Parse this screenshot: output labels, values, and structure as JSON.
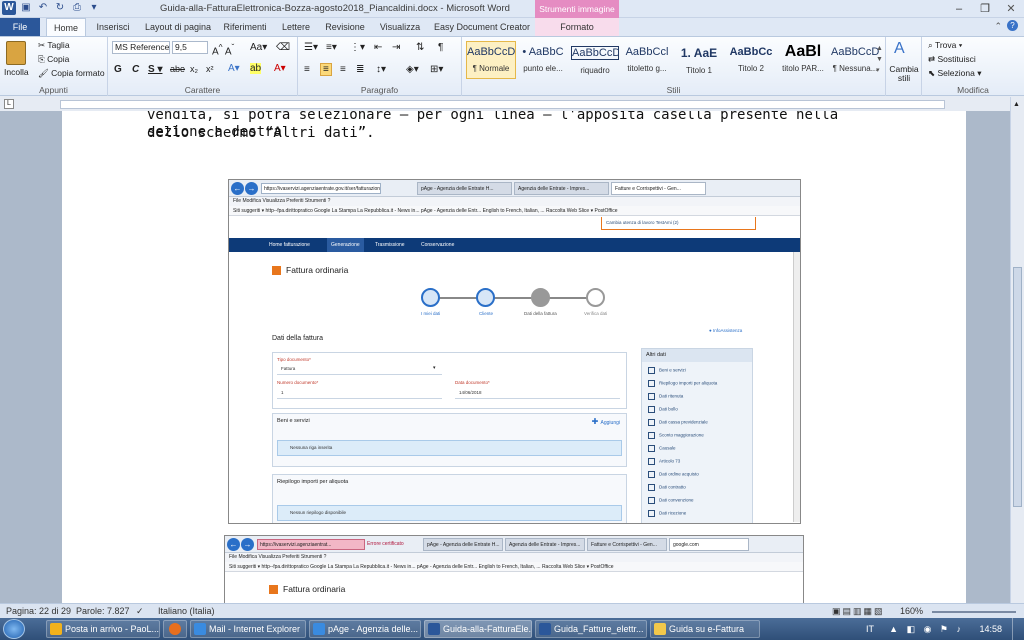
{
  "window": {
    "title": "Guida-alla-FatturaElettronica-Bozza-agosto2018_Piancaldini.docx - Microsoft Word",
    "context_tab_group": "Strumenti immagine",
    "controls": [
      "minimize",
      "restore",
      "close"
    ]
  },
  "ribbon_tabs": [
    "File",
    "Home",
    "Inserisci",
    "Layout di pagina",
    "Riferimenti",
    "Lettere",
    "Revisione",
    "Visualizza",
    "Easy Document Creator",
    "Formato"
  ],
  "ribbon": {
    "appunti": {
      "label": "Appunti",
      "paste": "Incolla",
      "cut": "Taglia",
      "copy": "Copia",
      "format_painter": "Copia formato"
    },
    "carattere": {
      "label": "Carattere",
      "font": "MS Reference",
      "size": "9,5"
    },
    "paragrafo": {
      "label": "Paragrafo"
    },
    "stili": {
      "label": "Stili",
      "items": [
        {
          "preview": "AaBbCcDc",
          "name": "¶ Normale"
        },
        {
          "preview": "• AaBbC",
          "name": "punto ele..."
        },
        {
          "preview": "AaBbCcDi",
          "name": "riquadro"
        },
        {
          "preview": "AaBbCcl",
          "name": "titoletto g..."
        },
        {
          "preview": "1. AaE",
          "name": "Titolo 1"
        },
        {
          "preview": "AaBbCc",
          "name": "Titolo 2"
        },
        {
          "preview": "AaBl",
          "name": "titolo PAR..."
        },
        {
          "preview": "AaBbCcDc",
          "name": "¶ Nessuna..."
        }
      ],
      "change_styles": "Cambia stili"
    },
    "modifica": {
      "label": "Modifica",
      "find": "Trova",
      "replace": "Sostituisci",
      "select": "Seleziona"
    }
  },
  "document": {
    "text_line1": "vendita, si potrà selezionare – per ogni linea – l'apposita casella presente nella sezione a destra",
    "text_line2": "dello schermo “Altri dati”."
  },
  "screenshot1": {
    "address": "https://ivaservizi.agenziaentrate.gov.it/ser/fatturazione",
    "tabs": [
      "pAge - Agenzia delle Entrate H...",
      "Agenzia delle Entrate - Impres...",
      "Fatture e Corrispettivi - Gen..."
    ],
    "menu": "File   Modifica   Visualizza   Preferiti   Strumenti   ?",
    "favorites": "Siti suggeriti ▾   http--fpa.dirittopratico   Google   La Stampa   La Repubblica.it - News in...   pAge - Agenzia delle Entr...   English to French, Italian, ...   Raccolta Web Slice ▾   PostOffice",
    "utenza": "Cambia utenza di lavoro    TestAmi (2)",
    "nav": [
      "Home fatturazione",
      "Generazione",
      "Trasmissione",
      "Conservazione"
    ],
    "heading": "Fattura ordinaria",
    "steps": [
      "I miei dati",
      "Cliente",
      "Dati della fattura",
      "Verifica dati"
    ],
    "section_title": "Dati della fattura",
    "info_link": "InfoAssistenza",
    "tipo_label": "Tipo documento*",
    "tipo_value": "Fattura",
    "numero_label": "Numero documento*",
    "numero_value": "1",
    "data_label": "Data documento*",
    "data_value": "14/06/2018",
    "beni_title": "Beni e servizi",
    "aggiungi": "Aggiungi",
    "beni_info": "Nessuna riga inserita",
    "riepilogo_title": "Riepilogo importi per aliquota",
    "riepilogo_info": "Nessun riepilogo disponibile",
    "altri_dati_title": "Altri dati",
    "altri_dati": [
      "Beni e servizi",
      "Riepilogo importi per aliquota",
      "Dati ritenuta",
      "Dati bollo",
      "Dati cassa previdenziale",
      "Sconto maggiorazione",
      "Causale",
      "Articolo 73",
      "Dati ordine acquisto",
      "Dati contratto",
      "Dati convenzione",
      "Dati ricezione"
    ]
  },
  "screenshot2": {
    "address": "https://ivaservizi.agenziaentrat...",
    "cert_error": "Errore certificato",
    "tabs": [
      "pAge - Agenzia delle Entrate H...",
      "Agenzia delle Entrate - Impres...",
      "Fatture e Corrispettivi - Gen...",
      "google.com"
    ],
    "menu": "File   Modifica   Visualizza   Preferiti   Strumenti   ?",
    "favorites": "Siti suggeriti ▾   http--fpa.dirittopratico   Google   La Stampa   La Repubblica.it - News in...   pAge - Agenzia delle Entr...   English to French, Italian, ...   Raccolta Web Slice ▾   PostOffice",
    "heading": "Fattura ordinaria"
  },
  "statusbar": {
    "page": "Pagina: 22 di 29",
    "words": "Parole: 7.827",
    "language": "Italiano (Italia)",
    "zoom": "160%"
  },
  "taskbar": {
    "items": [
      {
        "label": "Posta in arrivo - PaoL...",
        "color": "#f2b21b"
      },
      {
        "label": "",
        "color": "#e76f1e"
      },
      {
        "label": "Mail - Internet Explorer",
        "color": "#3a8be0"
      },
      {
        "label": "pAge - Agenzia delle...",
        "color": "#3a8be0"
      },
      {
        "label": "Guida-alla-FatturaEle...",
        "color": "#2b579a"
      },
      {
        "label": "Guida_Fatture_elettr...",
        "color": "#2b579a"
      },
      {
        "label": "Guida su e-Fattura",
        "color": "#f2c84b"
      }
    ],
    "lang": "IT",
    "time": "14:58"
  },
  "colors": {
    "word_blue": "#2b579a",
    "nav_blue": "#0d3a78",
    "accent_orange": "#e8761c",
    "pink_context": "#e58cc2"
  }
}
